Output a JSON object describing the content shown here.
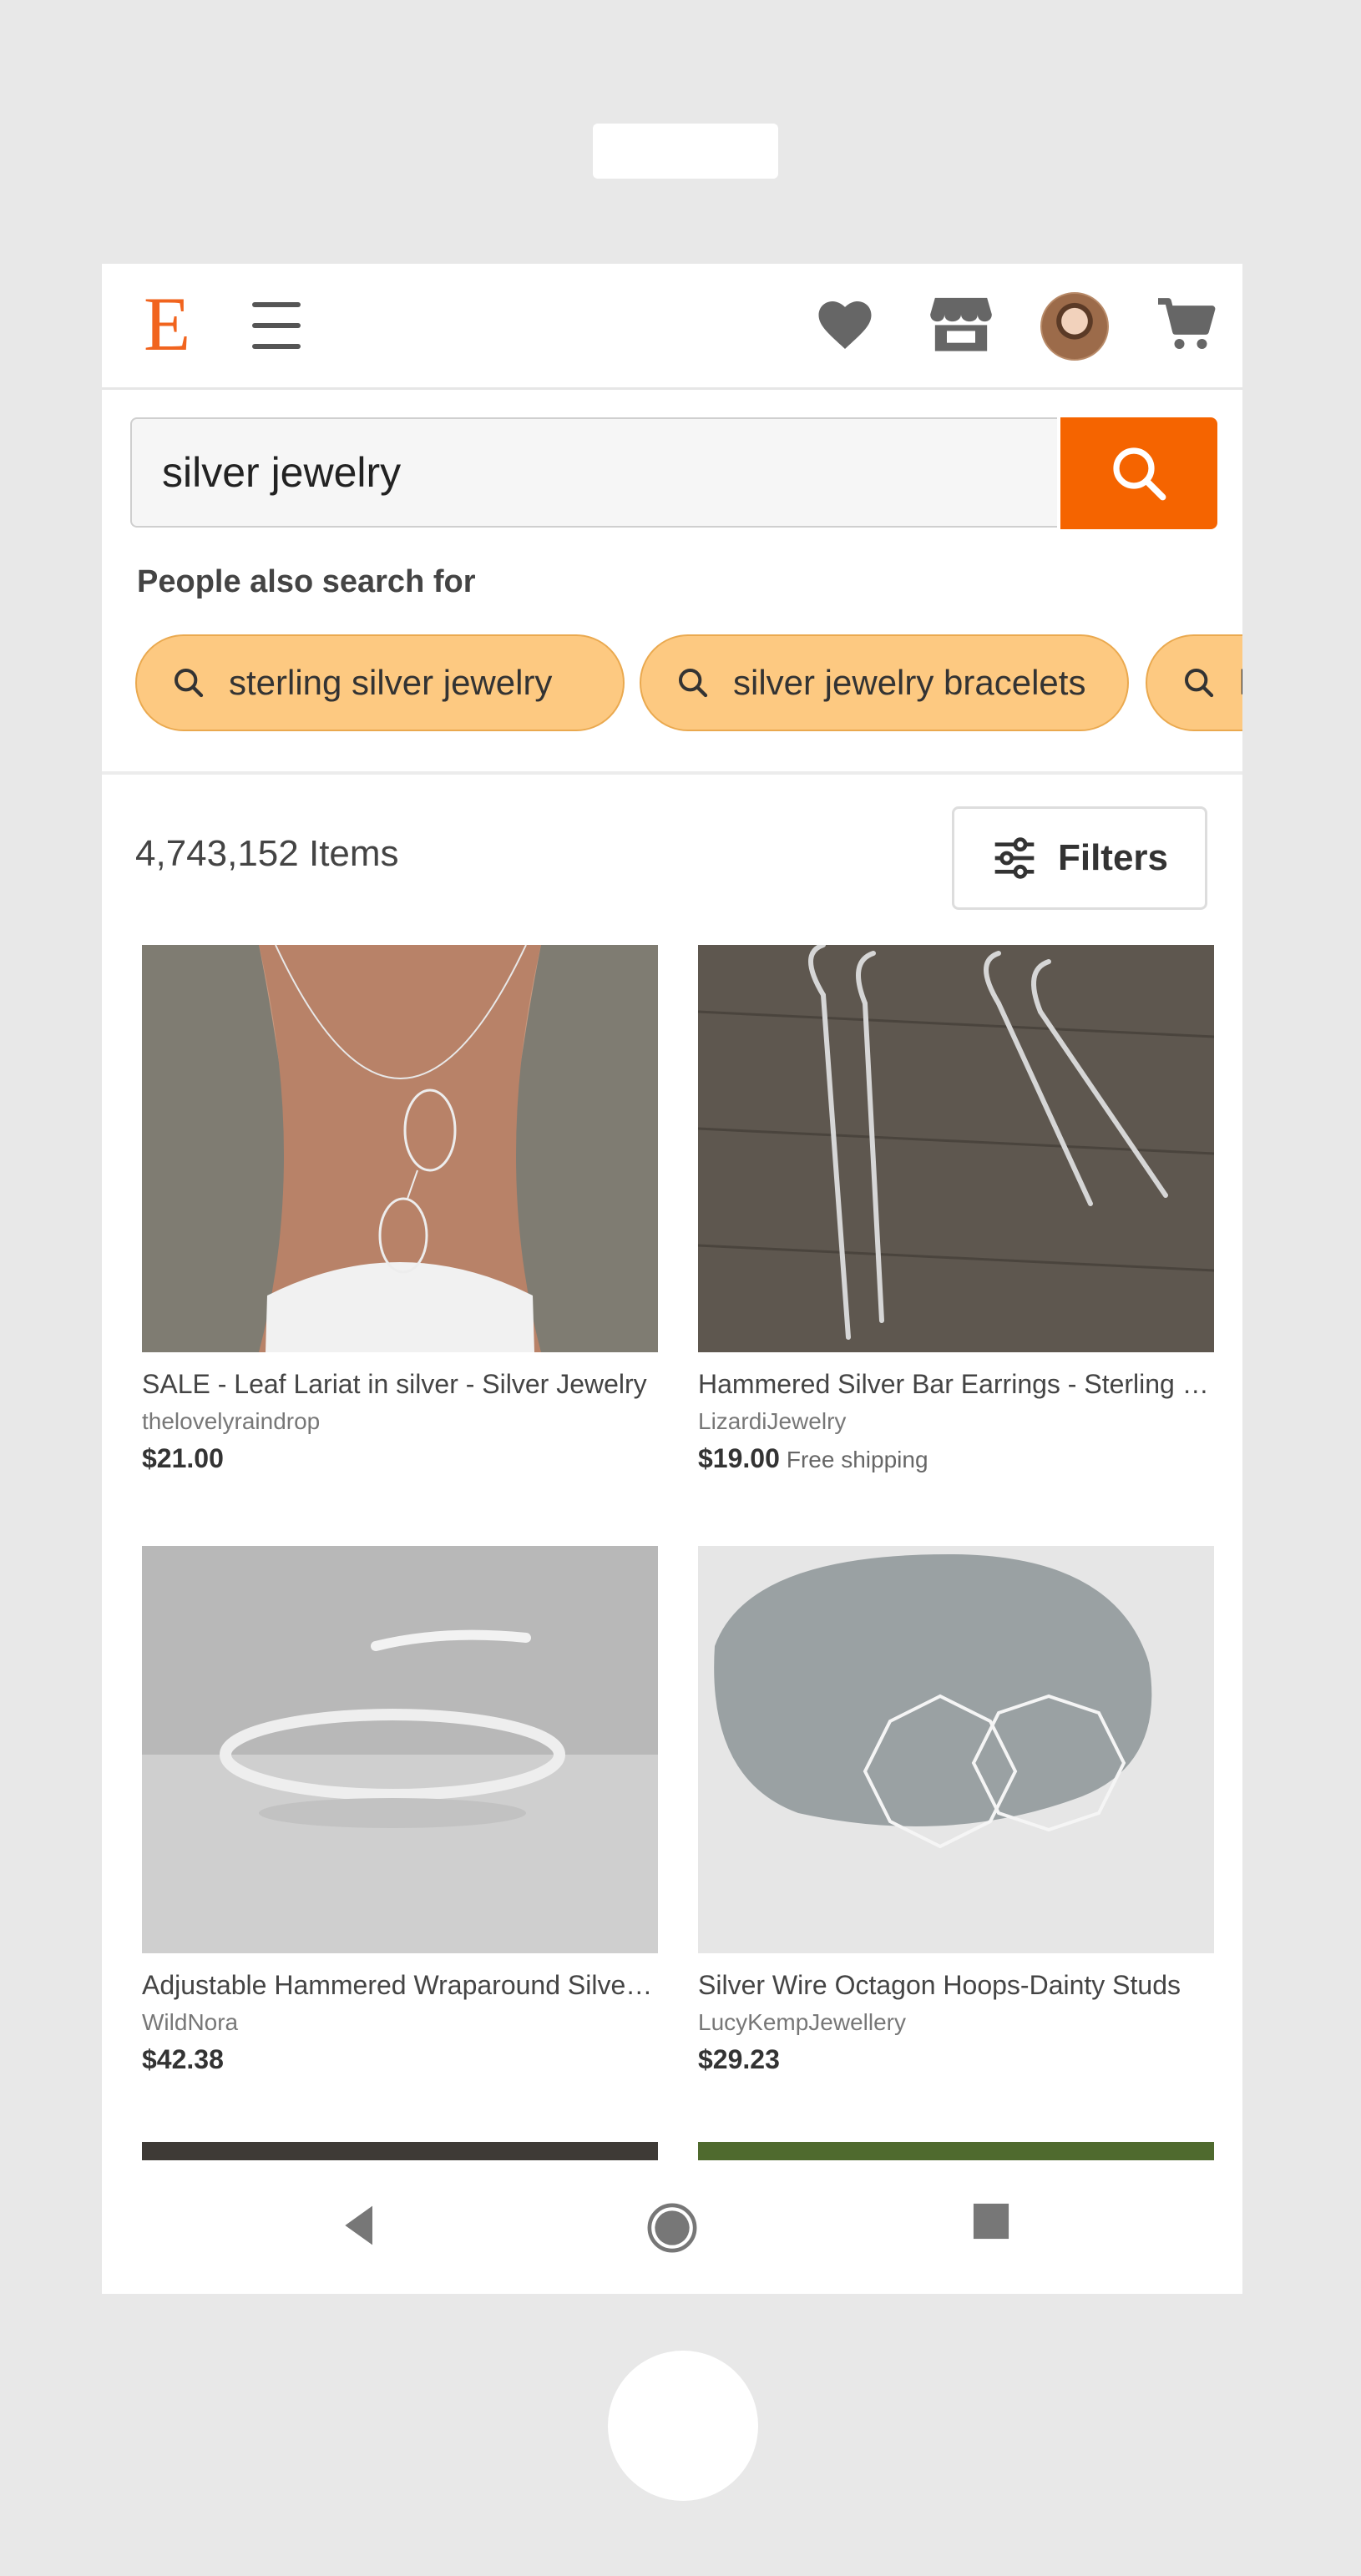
{
  "app": {
    "name": "Etsy",
    "logo_letter": "E",
    "accent": "#f1641e"
  },
  "header": {
    "icons": [
      "hamburger-menu-icon",
      "heart-icon",
      "shop-icon",
      "avatar",
      "cart-icon"
    ]
  },
  "search": {
    "value": "silver jewelry",
    "button_icon": "search-icon"
  },
  "suggestions": {
    "title": "People also search for",
    "chips": [
      "sterling silver jewelry",
      "silver jewelry bracelets",
      "l"
    ]
  },
  "results": {
    "count_label": "4,743,152 Items",
    "filters_label": "Filters",
    "items": [
      {
        "title": "SALE - Leaf Lariat in silver - Silver Jewelry",
        "shop": "thelovelyraindrop",
        "price": "$21.00",
        "shipping": ""
      },
      {
        "title": "Hammered Silver Bar Earrings - Sterling Silver",
        "shop": "LizardiJewelry",
        "price": "$19.00",
        "shipping": "Free shipping"
      },
      {
        "title": "Adjustable Hammered Wraparound Silver Ring",
        "shop": "WildNora",
        "price": "$42.38",
        "shipping": ""
      },
      {
        "title": "Silver Wire Octagon Hoops-Dainty Studs",
        "shop": "LucyKempJewellery",
        "price": "$29.23",
        "shipping": ""
      }
    ]
  },
  "system_nav": {
    "icons": [
      "back-icon",
      "home-icon",
      "recents-icon"
    ]
  }
}
